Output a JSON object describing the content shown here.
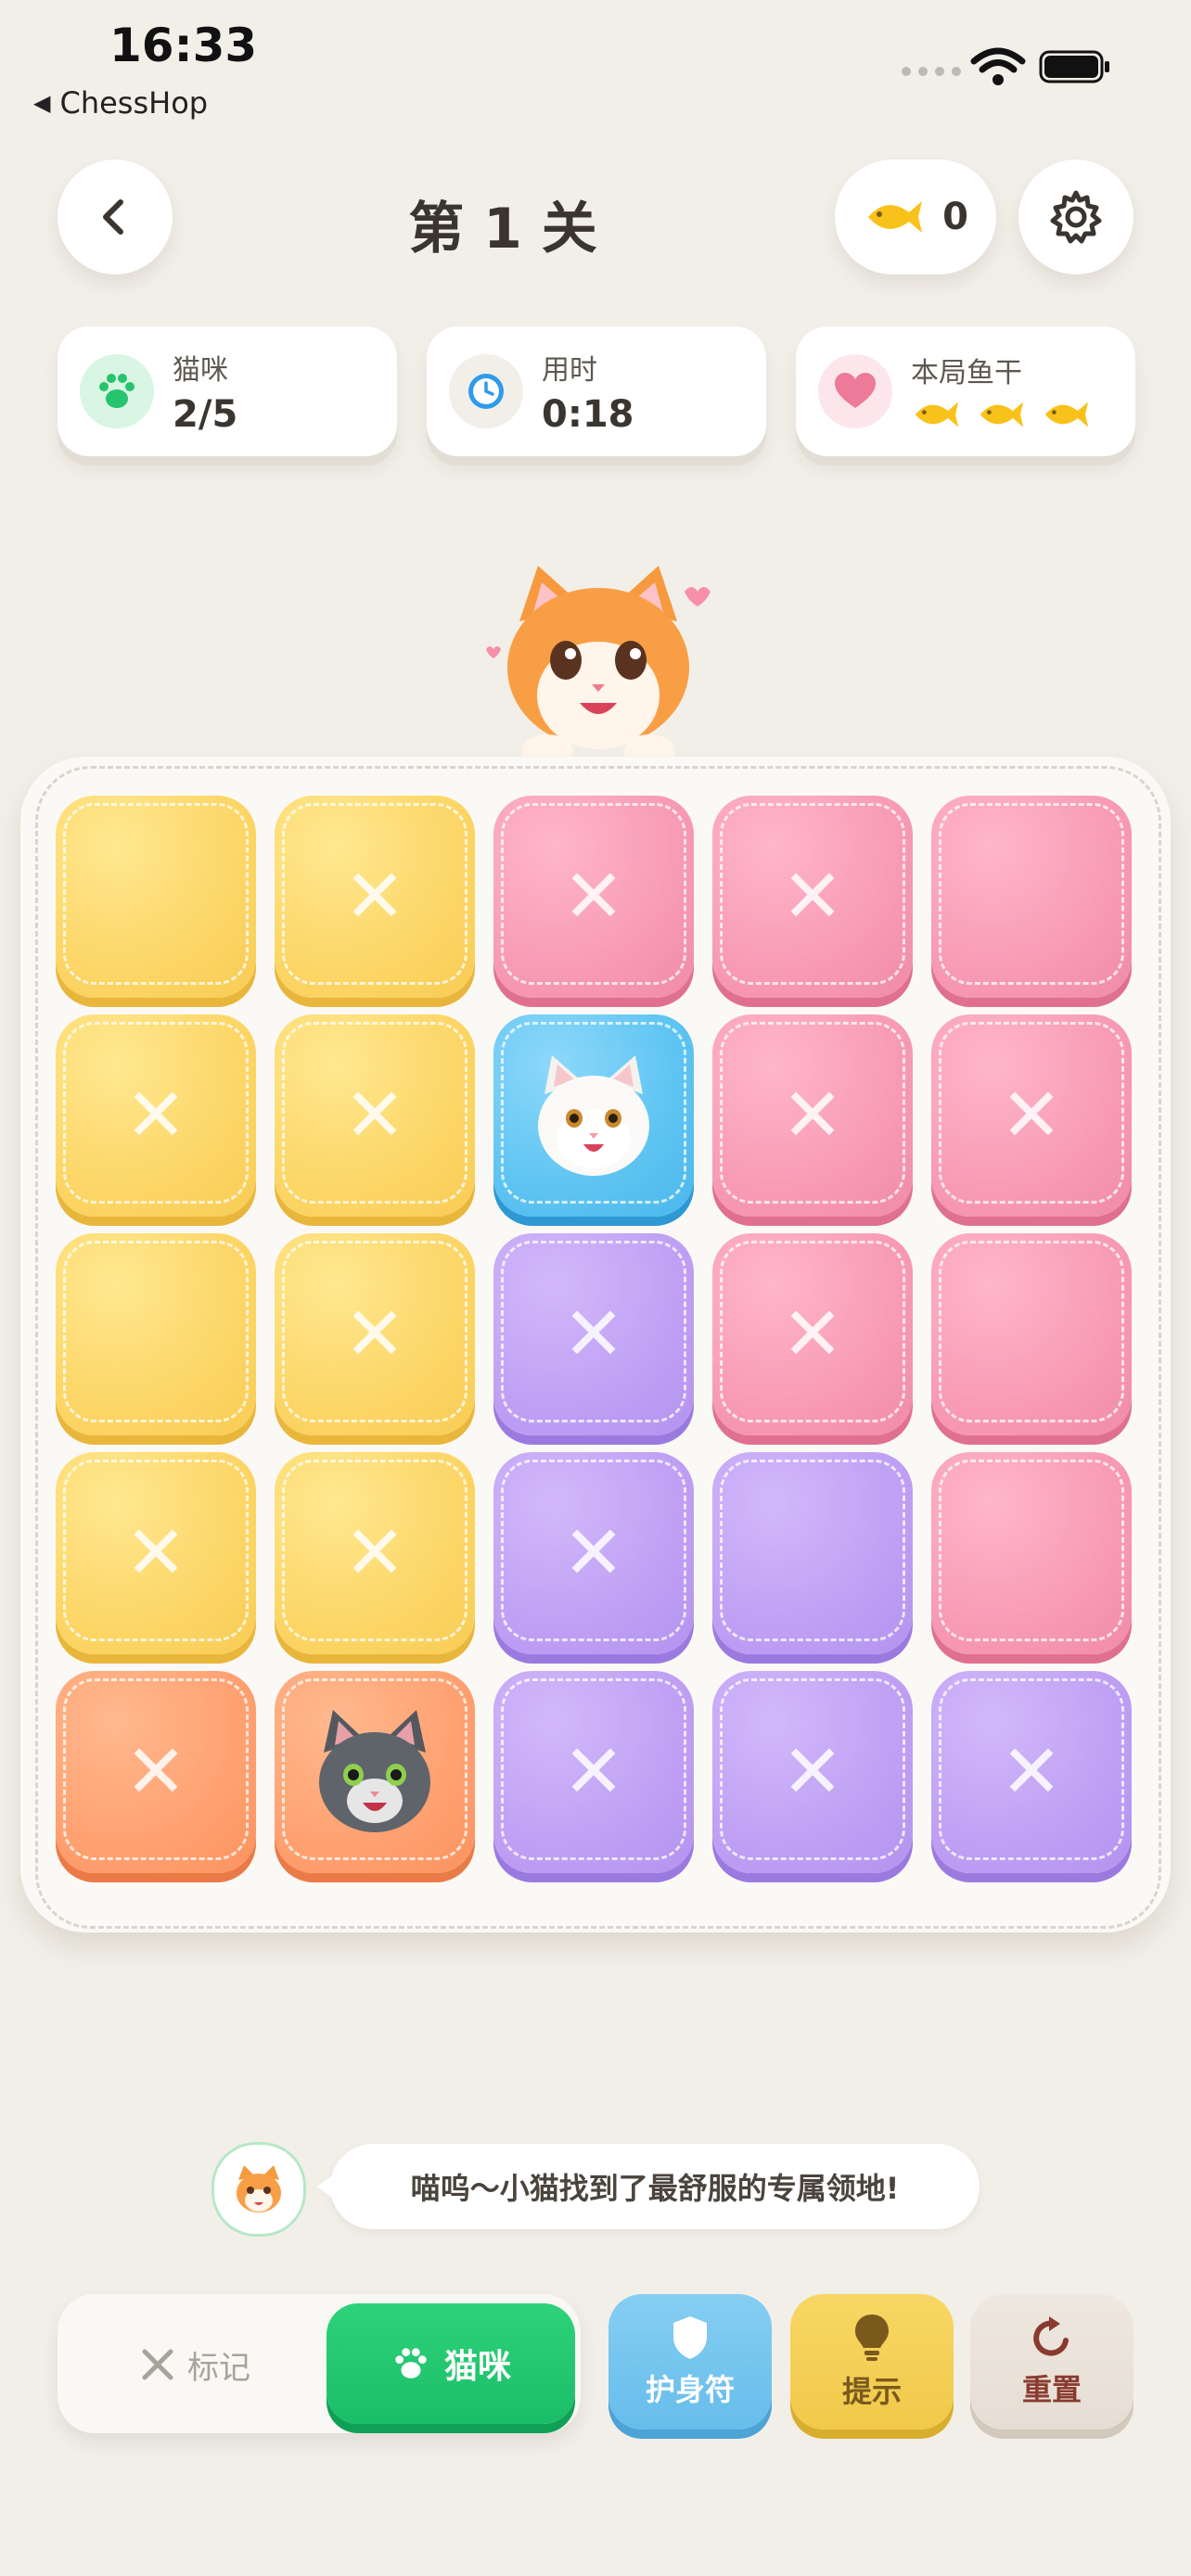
{
  "status_bar": {
    "time": "16:33",
    "back_app": "ChessHop"
  },
  "header": {
    "title": "第 1 关",
    "fish_count": "0"
  },
  "stats": [
    {
      "label": "猫咪",
      "value": "2/5",
      "icon": "paw-icon",
      "color": "#26C46E"
    },
    {
      "label": "用时",
      "value": "0:18",
      "icon": "clock-icon",
      "color": "#2E9BEA"
    },
    {
      "label": "本局鱼干",
      "value": "",
      "icon": "heart-icon",
      "color": "#EE7A99",
      "fish_remaining": 3
    }
  ],
  "board": {
    "rows": [
      [
        {
          "color": "yellow",
          "state": "empty"
        },
        {
          "color": "yellow",
          "state": "x"
        },
        {
          "color": "pink",
          "state": "x"
        },
        {
          "color": "pink",
          "state": "x"
        },
        {
          "color": "pink",
          "state": "empty"
        }
      ],
      [
        {
          "color": "yellow",
          "state": "x"
        },
        {
          "color": "yellow",
          "state": "x"
        },
        {
          "color": "blue",
          "state": "cat-white"
        },
        {
          "color": "pink",
          "state": "x"
        },
        {
          "color": "pink",
          "state": "x"
        }
      ],
      [
        {
          "color": "yellow",
          "state": "empty"
        },
        {
          "color": "yellow",
          "state": "x"
        },
        {
          "color": "purple",
          "state": "x"
        },
        {
          "color": "pink",
          "state": "x"
        },
        {
          "color": "pink",
          "state": "empty"
        }
      ],
      [
        {
          "color": "yellow",
          "state": "x"
        },
        {
          "color": "yellow",
          "state": "x"
        },
        {
          "color": "purple",
          "state": "x"
        },
        {
          "color": "purple",
          "state": "empty"
        },
        {
          "color": "pink",
          "state": "empty"
        }
      ],
      [
        {
          "color": "orange",
          "state": "x"
        },
        {
          "color": "orange",
          "state": "cat-gray"
        },
        {
          "color": "purple",
          "state": "x"
        },
        {
          "color": "purple",
          "state": "x"
        },
        {
          "color": "purple",
          "state": "x"
        }
      ]
    ]
  },
  "message": {
    "text": "喵呜～小猫找到了最舒服的专属领地!"
  },
  "toolbar": {
    "mark_label": "标记",
    "cat_label": "猫咪",
    "shield_label": "护身符",
    "hint_label": "提示",
    "reset_label": "重置"
  },
  "colors": {
    "yellow": "#FCD667",
    "pink": "#F89BB5",
    "purple": "#BFA0F4",
    "orange": "#FFA171",
    "blue": "#5EC4F2",
    "green": "#1BBE68"
  }
}
